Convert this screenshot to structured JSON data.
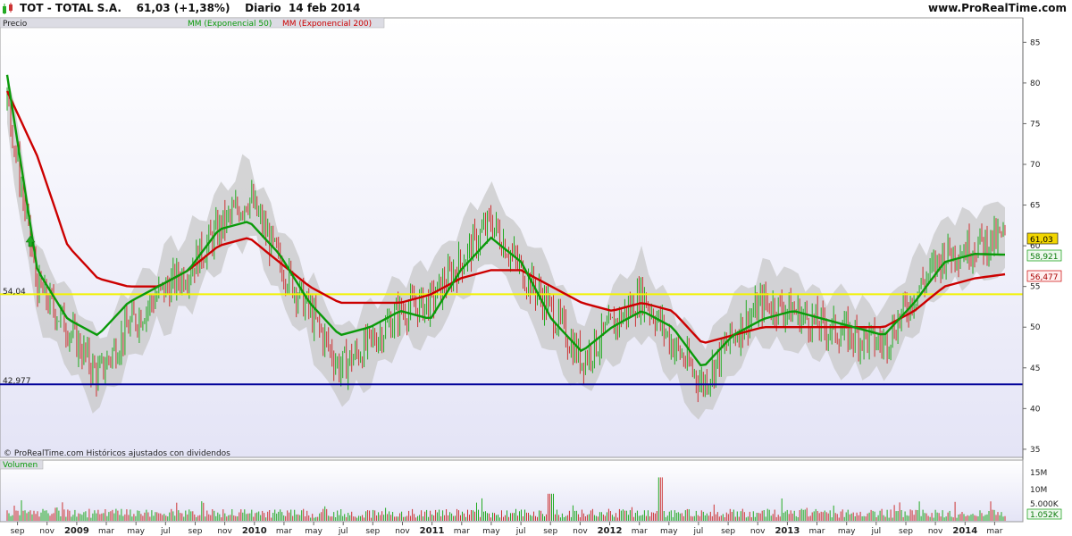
{
  "header": {
    "title": "TOT - TOTAL S.A.    61,03 (+1,38%)    Diario  14 feb 2014",
    "brand": "www.ProRealTime.com"
  },
  "price_panel": {
    "label": "Precio",
    "legend_ema50": "MM (Exponencial 50)",
    "legend_ema200": "MM (Exponencial 200)",
    "footer": "© ProRealTime.com  Históricos ajustados con dividendos",
    "last_price_badge": "61,03",
    "ema50_badge": "58,921",
    "ema200_badge": "56,477",
    "level_yellow_label": "54,04",
    "level_blue_label": "42,977"
  },
  "volume_panel": {
    "label": "Volumen",
    "y_labels": [
      "15M",
      "10M",
      "5.000K"
    ],
    "last_volume_badge": "1.052K"
  },
  "colors": {
    "ema50": "#0a9a0a",
    "ema200": "#cc0000",
    "yellow_level": "#f2f200",
    "blue_level": "#000099",
    "bull": "#22aa22",
    "bear": "#cc3333",
    "band": "#c8c8c8"
  },
  "icons": {
    "logo": "candlestick-icon",
    "signal": "up-arrow-icon"
  },
  "chart_data": {
    "type": "line",
    "title": "TOT - TOTAL S.A.",
    "x_tick_labels": [
      "sep",
      "nov",
      "2009",
      "mar",
      "may",
      "jul",
      "sep",
      "nov",
      "2010",
      "mar",
      "may",
      "jul",
      "sep",
      "nov",
      "2011",
      "mar",
      "may",
      "jul",
      "sep",
      "nov",
      "2012",
      "mar",
      "may",
      "jul",
      "sep",
      "nov",
      "2013",
      "mar",
      "may",
      "jul",
      "sep",
      "nov",
      "2014",
      "mar"
    ],
    "y_tick_labels": [
      "35",
      "40",
      "45",
      "50",
      "55",
      "60",
      "65",
      "70",
      "75",
      "80",
      "85"
    ],
    "ylim": [
      34,
      88
    ],
    "x_dates": [
      "2008-08",
      "2008-10",
      "2008-12",
      "2009-02",
      "2009-04",
      "2009-06",
      "2009-08",
      "2009-10",
      "2009-12",
      "2010-02",
      "2010-04",
      "2010-06",
      "2010-08",
      "2010-10",
      "2010-12",
      "2011-02",
      "2011-04",
      "2011-06",
      "2011-08",
      "2011-10",
      "2011-12",
      "2012-02",
      "2012-04",
      "2012-06",
      "2012-08",
      "2012-10",
      "2012-12",
      "2013-02",
      "2013-04",
      "2013-06",
      "2013-08",
      "2013-10",
      "2013-12",
      "2014-02"
    ],
    "series": [
      {
        "name": "Precio",
        "values": [
          78,
          55,
          50,
          44,
          50,
          54,
          57,
          62,
          66,
          58,
          52,
          45,
          48,
          52,
          53,
          58,
          63,
          57,
          52,
          46,
          50,
          54,
          48,
          43,
          49,
          53,
          52,
          50,
          49,
          48,
          54,
          59,
          60,
          61
        ]
      },
      {
        "name": "MM (Exponencial 50)",
        "values": [
          81,
          57,
          51,
          49,
          53,
          55,
          57,
          62,
          63,
          59,
          53,
          49,
          50,
          52,
          51,
          57,
          61,
          58,
          51,
          47,
          50,
          52,
          50,
          45,
          49,
          51,
          52,
          51,
          50,
          49,
          53,
          58,
          59,
          58.9
        ]
      },
      {
        "name": "MM (Exponencial 200)",
        "values": [
          79,
          71,
          60,
          56,
          55,
          55,
          57,
          60,
          61,
          58,
          55,
          53,
          53,
          53,
          54,
          56,
          57,
          57,
          55,
          53,
          52,
          53,
          52,
          48,
          49,
          50,
          50,
          50,
          50,
          50,
          52,
          55,
          56,
          56.5
        ]
      }
    ],
    "horizontal_lines": [
      {
        "label": "54,04",
        "value": 54.04
      },
      {
        "label": "42,977",
        "value": 42.977
      }
    ],
    "volume_ylim": [
      0,
      17
    ]
  }
}
